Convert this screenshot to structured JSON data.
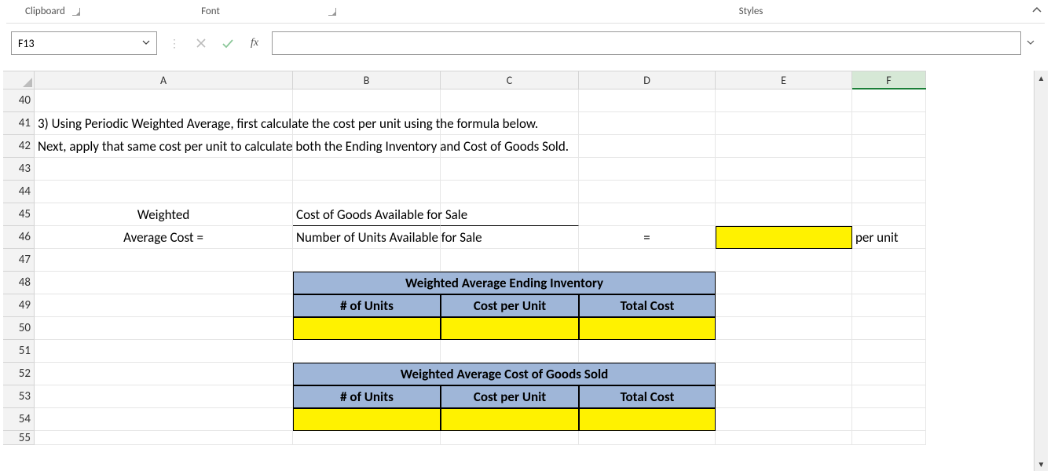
{
  "ribbon": {
    "groups": {
      "clipboard": "Clipboard",
      "font": "Font",
      "styles": "Styles"
    }
  },
  "formula_bar": {
    "name_box": "F13",
    "formula": "",
    "fx_label": "fx"
  },
  "columns": [
    "A",
    "B",
    "C",
    "D",
    "E",
    "F"
  ],
  "rows_visible": [
    "40",
    "41",
    "42",
    "43",
    "44",
    "45",
    "46",
    "47",
    "48",
    "49",
    "50",
    "51",
    "52",
    "53",
    "54",
    "55"
  ],
  "cells": {
    "r41": "3) Using Periodic Weighted Average, first calculate the cost per unit using the formula below.",
    "r42": "Next, apply that same cost per unit to calculate both the Ending Inventory and Cost of Goods Sold.",
    "r45_A": "Weighted",
    "r46_A": "Average Cost  =",
    "r45_B": "Cost of Goods Available for Sale",
    "r46_B": "Number of Units Available for Sale",
    "r46_D": "=",
    "r46_E": "",
    "r46_F": "per unit",
    "r48_title": "Weighted Average Ending Inventory",
    "r49_c1": "# of Units",
    "r49_c2": "Cost per Unit",
    "r49_c3": "Total Cost",
    "r52_title": "Weighted Average Cost of Goods Sold",
    "r53_c1": "# of Units",
    "r53_c2": "Cost per Unit",
    "r53_c3": "Total Cost"
  }
}
